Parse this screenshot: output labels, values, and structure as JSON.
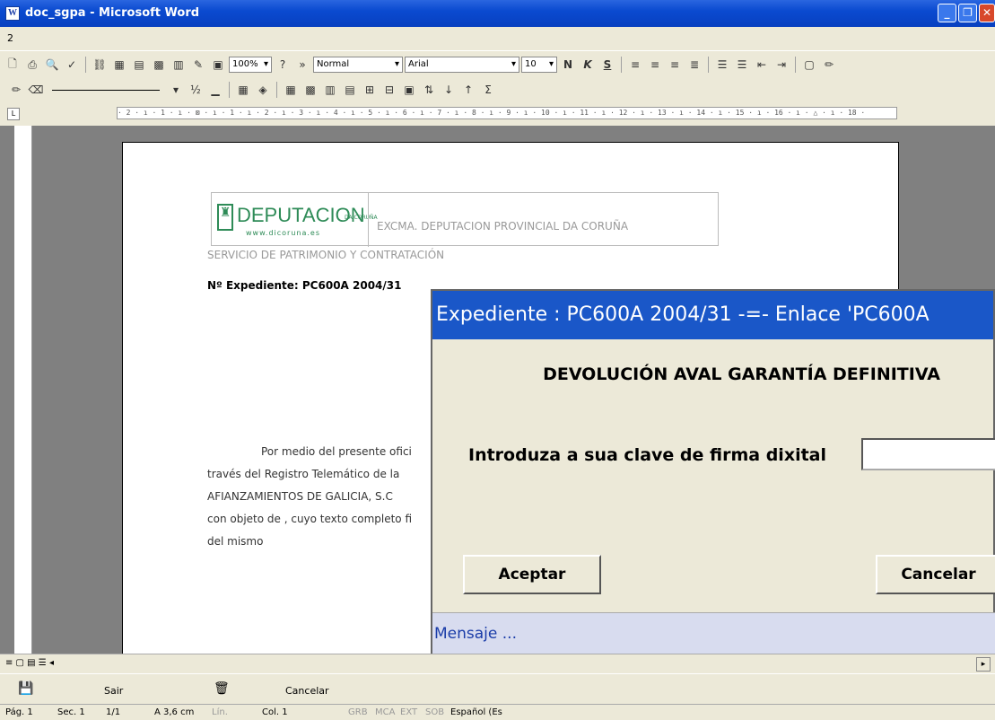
{
  "window": {
    "title": "doc_sgpa - Microsoft Word",
    "min_icon": "minimize-icon",
    "max_icon": "maximize-icon",
    "close_icon": "close-icon"
  },
  "menu": {
    "item": "2"
  },
  "toolbar": {
    "zoom": "100%",
    "style": "Normal",
    "font": "Arial",
    "size": "10",
    "bold": "N",
    "italic": "K",
    "underline": "S",
    "line_weight": "½"
  },
  "ruler": {
    "marks": "· 2 · ı · 1 · ı · ⊠ · ı · 1 · ı · 2 · ı · 3 · ı · 4 · ı · 5 · ı · 6 · ı · 7 · ı · 8 · ı · 9 · ı · 10 · ı · 11 · ı · 12 · ı · 13 · ı · 14 · ı · 15 · ı · 16 · ı · △ · ı · 18 ·"
  },
  "document": {
    "logo_text": "DEPUTACION",
    "logo_url": "www.dicoruna.es",
    "logo_small": "DA CORUÑA",
    "org": "EXCMA. DEPUTACION PROVINCIAL DA CORUÑA",
    "service": "SERVICIO DE PATRIMONIO Y  CONTRATACIÓN",
    "expediente": "Nº Expediente: PC600A 2004/31",
    "body_lines": [
      "Por medio del presente ofici",
      "través del Registro Telemático de la",
      "AFIANZAMIENTOS DE GALICIA, S.C",
      "con objeto de , cuyo texto completo fi",
      "del mismo"
    ]
  },
  "dialog": {
    "title": "Expediente : PC600A 2004/31  -=-  Enlace 'PC600A",
    "heading": "DEVOLUCIÓN AVAL GARANTÍA DEFINITIVA",
    "prompt": "Introduza a sua clave de firma dixital",
    "password_value": "",
    "accept": "Aceptar",
    "cancel": "Cancelar",
    "message": "Mensaje ..."
  },
  "bottom_toolbar": {
    "exit": "Sair",
    "cancel": "Cancelar"
  },
  "status": {
    "page": "Pág. 1",
    "section": "Sec. 1",
    "pages": "1/1",
    "at": "A 3,6 cm",
    "line": "Lín.",
    "col": "Col. 1",
    "grb": "GRB",
    "mca": "MCA",
    "ext": "EXT",
    "sob": "SOB",
    "language": "Español (Es"
  }
}
